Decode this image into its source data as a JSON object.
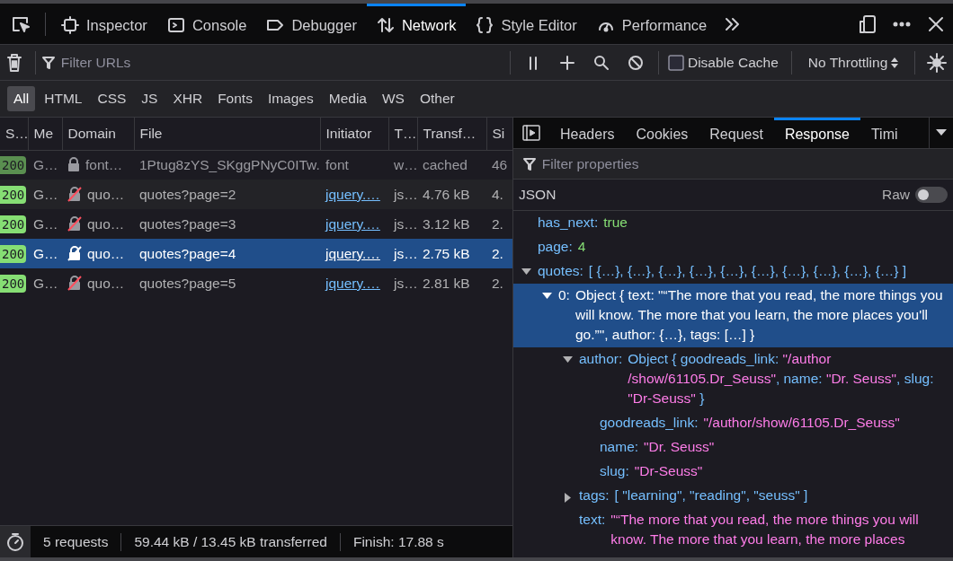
{
  "toolbox": {
    "tabs": [
      {
        "label": "Inspector",
        "selected": false
      },
      {
        "label": "Console",
        "selected": false
      },
      {
        "label": "Debugger",
        "selected": false
      },
      {
        "label": "Network",
        "selected": true
      },
      {
        "label": "Style Editor",
        "selected": false
      },
      {
        "label": "Performance",
        "selected": false
      }
    ]
  },
  "filter": {
    "placeholder": "Filter URLs"
  },
  "disable_cache": {
    "label": "Disable Cache",
    "checked": false
  },
  "throttling": "No Throttling",
  "type_filters": [
    {
      "label": "All",
      "selected": true
    },
    {
      "label": "HTML",
      "selected": false
    },
    {
      "label": "CSS",
      "selected": false
    },
    {
      "label": "JS",
      "selected": false
    },
    {
      "label": "XHR",
      "selected": false
    },
    {
      "label": "Fonts",
      "selected": false
    },
    {
      "label": "Images",
      "selected": false
    },
    {
      "label": "Media",
      "selected": false
    },
    {
      "label": "WS",
      "selected": false
    },
    {
      "label": "Other",
      "selected": false
    }
  ],
  "table": {
    "columns": [
      "S…",
      "Me",
      "Domain",
      "File",
      "Initiator",
      "T…",
      "Transf…",
      "Si"
    ],
    "rows": [
      {
        "status": "200",
        "method": "G…",
        "secure": true,
        "domain": "font…",
        "file": "1Ptug8zYS_SKggPNyC0ITw.",
        "initiator": "font",
        "initiator_link": false,
        "type": "w…",
        "transferred": "cached",
        "size": "46",
        "cached": true,
        "selected": false
      },
      {
        "status": "200",
        "method": "G…",
        "secure": false,
        "domain": "quo…",
        "file": "quotes?page=2",
        "initiator": "jquery.…",
        "initiator_link": true,
        "type": "js…",
        "transferred": "4.76 kB",
        "size": "4.",
        "cached": false,
        "selected": false
      },
      {
        "status": "200",
        "method": "G…",
        "secure": false,
        "domain": "quo…",
        "file": "quotes?page=3",
        "initiator": "jquery.…",
        "initiator_link": true,
        "type": "js…",
        "transferred": "3.12 kB",
        "size": "2.",
        "cached": false,
        "selected": false
      },
      {
        "status": "200",
        "method": "G…",
        "secure": false,
        "domain": "quo…",
        "file": "quotes?page=4",
        "initiator": "jquery.…",
        "initiator_link": true,
        "type": "js…",
        "transferred": "2.75 kB",
        "size": "2.",
        "cached": false,
        "selected": true
      },
      {
        "status": "200",
        "method": "G…",
        "secure": false,
        "domain": "quo…",
        "file": "quotes?page=5",
        "initiator": "jquery.…",
        "initiator_link": true,
        "type": "js…",
        "transferred": "2.81 kB",
        "size": "2.",
        "cached": false,
        "selected": false
      }
    ]
  },
  "details": {
    "tabs": [
      {
        "label": "Headers",
        "selected": false
      },
      {
        "label": "Cookies",
        "selected": false
      },
      {
        "label": "Request",
        "selected": false
      },
      {
        "label": "Response",
        "selected": true
      },
      {
        "label": "Timi",
        "selected": false
      }
    ],
    "filter": {
      "placeholder": "Filter properties"
    },
    "format_label": "JSON",
    "raw_toggle": {
      "label": "Raw",
      "on": false
    },
    "tree": [
      {
        "key": "has_next:",
        "value": [
          {
            "text": "true",
            "kind": "literal"
          }
        ],
        "selected": false
      },
      {
        "key": "page:",
        "value": [
          {
            "text": "4",
            "kind": "literal"
          }
        ],
        "selected": false
      },
      {
        "key": "quotes:",
        "value": [
          {
            "text": "[ {…}, {…}, {…}, {…}, {…}, {…}, {…}, {…}, {…}, {…} ]",
            "kind": "plain"
          }
        ],
        "expanded": true,
        "selected": false,
        "children": [
          {
            "key": "0:",
            "value": [
              {
                "text": "Object { text: \"“The more that you read, the more things you will know. The more that you learn, the more places you'll go.”\", author: {…}, tags: […] }"
              }
            ],
            "expanded": true,
            "selected": true,
            "children": [
              {
                "key": "author:",
                "value": [
                  {
                    "text": "Object { goodreads_link: ",
                    "kind": "plain"
                  },
                  {
                    "text": "\"/author /show/61105.Dr_Seuss\"",
                    "kind": "string"
                  },
                  {
                    "text": ", name: ",
                    "kind": "plain"
                  },
                  {
                    "text": "\"Dr. Seuss\"",
                    "kind": "string"
                  },
                  {
                    "text": ", slug: ",
                    "kind": "plain"
                  },
                  {
                    "text": "\"Dr-Seuss\"",
                    "kind": "string"
                  },
                  {
                    "text": " }",
                    "kind": "plain"
                  }
                ],
                "expanded": true,
                "selected": false,
                "children": [
                  {
                    "key": "goodreads_link:",
                    "value": [
                      {
                        "text": "\"/author/show/61105.Dr_Seuss\"",
                        "kind": "string"
                      }
                    ],
                    "selected": false
                  },
                  {
                    "key": "name:",
                    "value": [
                      {
                        "text": "\"Dr. Seuss\"",
                        "kind": "string"
                      }
                    ],
                    "selected": false
                  },
                  {
                    "key": "slug:",
                    "value": [
                      {
                        "text": "\"Dr-Seuss\"",
                        "kind": "string"
                      }
                    ],
                    "selected": false
                  }
                ]
              },
              {
                "key": "tags:",
                "value": [
                  {
                    "text": "[ \"learning\", \"reading\", \"seuss\" ]",
                    "kind": "mixed"
                  }
                ],
                "expanded": false,
                "selected": false
              },
              {
                "key": "text:",
                "value": [
                  {
                    "text": "\"“The more that you read, the more things you will know. The more that you learn, the more places",
                    "kind": "string"
                  }
                ],
                "selected": false
              }
            ]
          }
        ]
      }
    ]
  },
  "status_bar": {
    "requests": "5 requests",
    "transferred": "59.44 kB / 13.45 kB transferred",
    "finish": "Finish: 17.88 s"
  }
}
